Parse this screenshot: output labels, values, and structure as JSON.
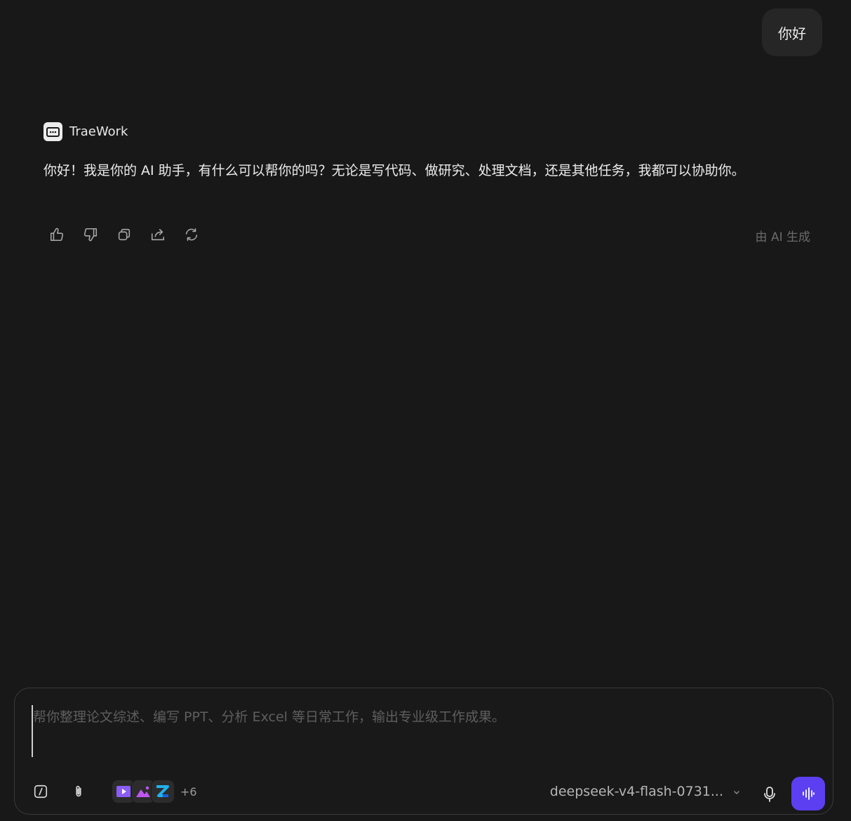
{
  "conversation": {
    "user_message": "你好",
    "assistant": {
      "name": "TraeWork",
      "message": "你好！我是你的 AI 助手，有什么可以帮你的吗？无论是写代码、做研究、处理文档，还是其他任务，我都可以协助你。",
      "ai_note": "由 AI 生成",
      "actions": [
        {
          "icon": "thumbs-up-icon"
        },
        {
          "icon": "thumbs-down-icon"
        },
        {
          "icon": "copy-icon"
        },
        {
          "icon": "share-icon"
        },
        {
          "icon": "regenerate-icon"
        }
      ]
    }
  },
  "composer": {
    "placeholder": "帮你整理论文综述、编写 PPT、分析 Excel 等日常工作，输出专业级工作成果。",
    "tools": [
      {
        "icon": "slash-command-icon"
      },
      {
        "icon": "paperclip-icon"
      }
    ],
    "skills": [
      {
        "icon": "video-icon",
        "color": "#8b5cf6"
      },
      {
        "icon": "image-icon",
        "color": "#c056f0"
      },
      {
        "icon": "design-app-icon",
        "color": "#22b0ee"
      }
    ],
    "skills_more": "+6",
    "model": "deepseek-v4-flash-0731...",
    "mic_icon": "microphone-icon",
    "voice_icon": "voice-wave-icon",
    "accent": "#5b3ff0"
  }
}
